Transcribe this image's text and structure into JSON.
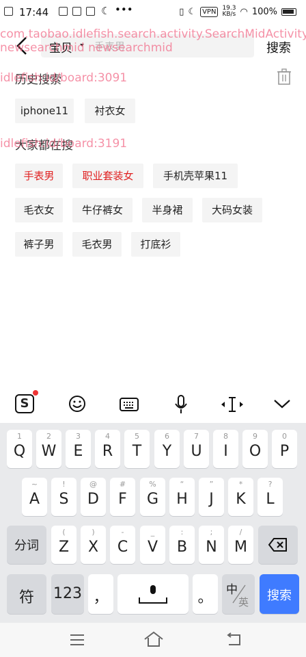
{
  "status_bar": {
    "time": "17:44",
    "vpn": "VPN",
    "speed": "19.3",
    "speed_unit": "KB/s",
    "battery": "100%"
  },
  "debug_overlay": {
    "activity_line1": "com.taobao.idlefish.search.activity.SearchMidActivity:",
    "activity_line2": "newsearchmid newsearchmid",
    "history_id": "idlefish:id/board:3091",
    "hot_id": "idlefish:id/board:3191"
  },
  "header": {
    "scope": "宝贝",
    "query": "手表男",
    "search_button": "搜索"
  },
  "history": {
    "title": "历史搜索",
    "items": [
      "iphone11",
      "衬衣女"
    ]
  },
  "hot": {
    "title": "大家都在搜",
    "rows": [
      [
        {
          "label": "手表男",
          "highlight": true
        },
        {
          "label": "职业套装女",
          "highlight": true
        },
        {
          "label": "手机壳苹果11",
          "highlight": false
        }
      ],
      [
        {
          "label": "毛衣女",
          "highlight": false
        },
        {
          "label": "牛仔裤女",
          "highlight": false
        },
        {
          "label": "半身裙",
          "highlight": false
        },
        {
          "label": "大码女装",
          "highlight": false
        }
      ],
      [
        {
          "label": "裤子男",
          "highlight": false
        },
        {
          "label": "毛衣男",
          "highlight": false
        },
        {
          "label": "打底衫",
          "highlight": false
        }
      ]
    ]
  },
  "keyboard": {
    "row1": [
      {
        "k": "Q",
        "s": "1"
      },
      {
        "k": "W",
        "s": "2"
      },
      {
        "k": "E",
        "s": "3"
      },
      {
        "k": "R",
        "s": "4"
      },
      {
        "k": "T",
        "s": "5"
      },
      {
        "k": "Y",
        "s": "6"
      },
      {
        "k": "U",
        "s": "7"
      },
      {
        "k": "I",
        "s": "8"
      },
      {
        "k": "O",
        "s": "9"
      },
      {
        "k": "P",
        "s": "0"
      }
    ],
    "row2": [
      {
        "k": "A",
        "s": "~"
      },
      {
        "k": "S",
        "s": "!"
      },
      {
        "k": "D",
        "s": "@"
      },
      {
        "k": "F",
        "s": "#"
      },
      {
        "k": "G",
        "s": "%"
      },
      {
        "k": "H",
        "s": "“"
      },
      {
        "k": "J",
        "s": "”"
      },
      {
        "k": "K",
        "s": "*"
      },
      {
        "k": "L",
        "s": "?"
      }
    ],
    "row3": [
      {
        "k": "Z",
        "s": "("
      },
      {
        "k": "X",
        "s": ")"
      },
      {
        "k": "C",
        "s": "-"
      },
      {
        "k": "V",
        "s": "_"
      },
      {
        "k": "B",
        "s": ":"
      },
      {
        "k": "N",
        "s": ";"
      },
      {
        "k": "M",
        "s": "/"
      }
    ],
    "segment_key": "分词",
    "symbol_key": "符",
    "num_key": "123",
    "comma_key": "，",
    "period_key": "。",
    "lang_key_cn": "中",
    "lang_key_en": "英",
    "search_key": "搜索"
  },
  "colors": {
    "accent_blue": "#3f7bff",
    "hot_red": "#e02020",
    "overlay_pink": "#f26d8a"
  }
}
